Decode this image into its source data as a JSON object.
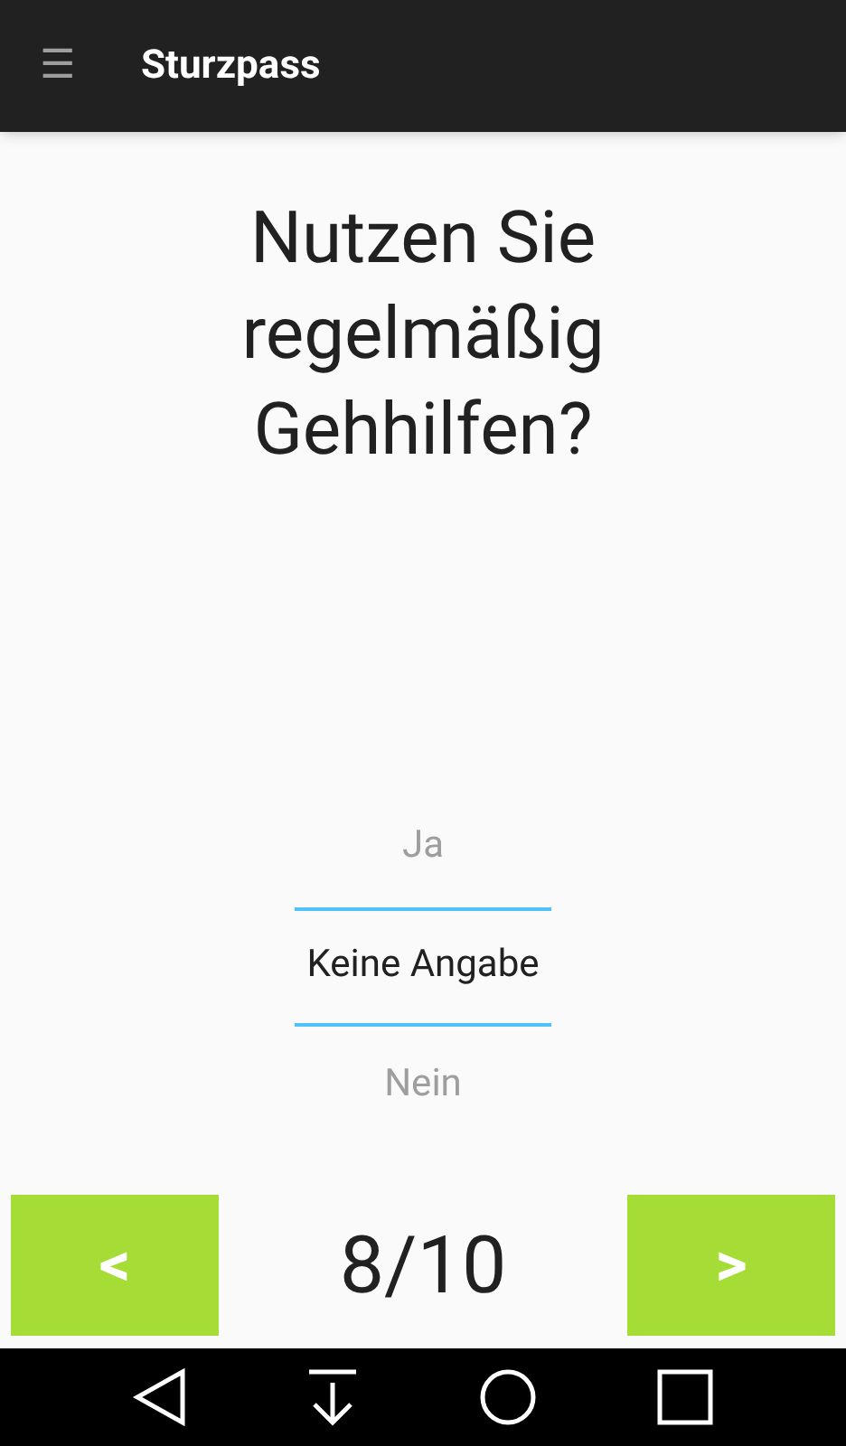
{
  "app_bar": {
    "menu_icon": "☰",
    "title": "Sturzpass"
  },
  "question": "Nutzen Sie regelmäßig Gehhilfen?",
  "picker": {
    "options": [
      {
        "label": "Ja",
        "selected": false
      },
      {
        "label": "Keine Angabe",
        "selected": true
      },
      {
        "label": "Nein",
        "selected": false
      }
    ]
  },
  "navigation": {
    "previous": "<",
    "counter": "8/10",
    "next": ">"
  }
}
